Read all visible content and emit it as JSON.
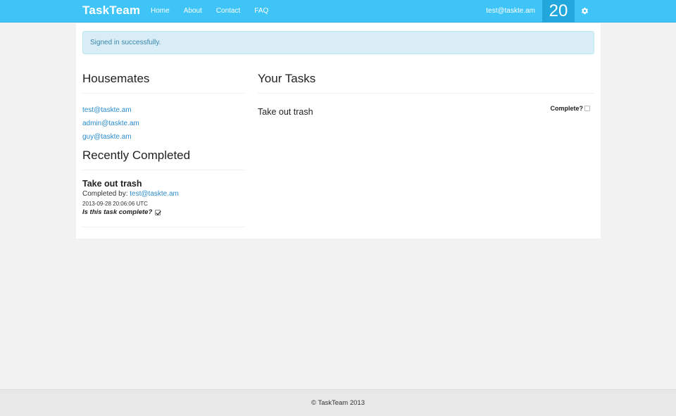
{
  "navbar": {
    "brand": "TaskTeam",
    "links": [
      "Home",
      "About",
      "Contact",
      "FAQ"
    ],
    "user_email": "test@taskte.am",
    "count": "20",
    "gear_icon": "gear-icon"
  },
  "alert": {
    "message": "Signed in successfully."
  },
  "housemates": {
    "title": "Housemates",
    "items": [
      "test@taskte.am",
      "admin@taskte.am",
      "guy@taskte.am"
    ]
  },
  "recently_completed": {
    "title": "Recently Completed",
    "items": [
      {
        "task": "Take out trash",
        "completed_by_label": "Completed by:",
        "completed_by": "test@taskte.am",
        "timestamp": "2013-09-28 20:06:06 UTC",
        "complete_question": "Is this task complete?",
        "complete": true
      }
    ]
  },
  "your_tasks": {
    "title": "Your Tasks",
    "items": [
      {
        "task": "Take out trash",
        "complete_label": "Complete?",
        "complete": false
      }
    ]
  },
  "footer": {
    "text": "© TaskTeam 2013"
  },
  "colors": {
    "navbar": "#3ec4f7",
    "count_bg": "#22a7dc",
    "link": "#2a8ccc",
    "alert_bg": "#d9edf7",
    "alert_text": "#3a87ad"
  }
}
